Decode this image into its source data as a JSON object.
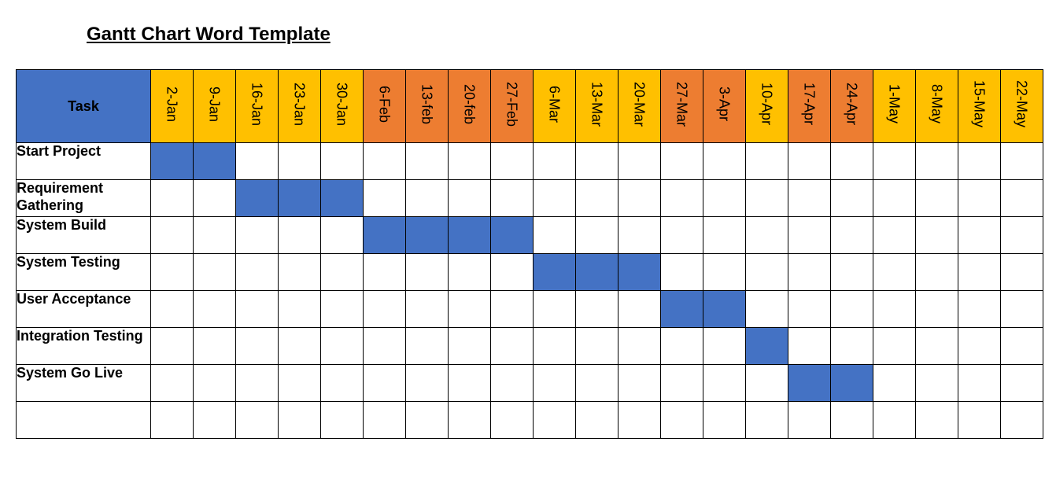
{
  "title": "Gantt Chart Word Template",
  "task_header": "Task",
  "colors": {
    "header_blue": "#4472c4",
    "bar_blue": "#4472c4",
    "month_a": "#ffc000",
    "month_b": "#ed7d31"
  },
  "columns": [
    {
      "label": "2-Jan",
      "colorKey": "month_a"
    },
    {
      "label": "9-Jan",
      "colorKey": "month_a"
    },
    {
      "label": "16-Jan",
      "colorKey": "month_a"
    },
    {
      "label": "23-Jan",
      "colorKey": "month_a"
    },
    {
      "label": "30-Jan",
      "colorKey": "month_a"
    },
    {
      "label": "6-Feb",
      "colorKey": "month_b"
    },
    {
      "label": "13-feb",
      "colorKey": "month_b"
    },
    {
      "label": "20-feb",
      "colorKey": "month_b"
    },
    {
      "label": "27-Feb",
      "colorKey": "month_b"
    },
    {
      "label": "6-Mar",
      "colorKey": "month_a"
    },
    {
      "label": "13-Mar",
      "colorKey": "month_a"
    },
    {
      "label": "20-Mar",
      "colorKey": "month_a"
    },
    {
      "label": "27-Mar",
      "colorKey": "month_b"
    },
    {
      "label": "3-Apr",
      "colorKey": "month_b"
    },
    {
      "label": "10-Apr",
      "colorKey": "month_a"
    },
    {
      "label": "17-Apr",
      "colorKey": "month_b"
    },
    {
      "label": "24-Apr",
      "colorKey": "month_b"
    },
    {
      "label": "1-May",
      "colorKey": "month_a"
    },
    {
      "label": "8-May",
      "colorKey": "month_a"
    },
    {
      "label": "15-May",
      "colorKey": "month_a"
    },
    {
      "label": "22-May",
      "colorKey": "month_a"
    }
  ],
  "tasks": [
    {
      "name": "Start Project",
      "start_col": 0,
      "end_col": 1
    },
    {
      "name": "Requirement Gathering",
      "start_col": 2,
      "end_col": 4
    },
    {
      "name": "System Build",
      "start_col": 5,
      "end_col": 8
    },
    {
      "name": "System Testing",
      "start_col": 9,
      "end_col": 11
    },
    {
      "name": "User Acceptance",
      "start_col": 12,
      "end_col": 13
    },
    {
      "name": "Integration Testing",
      "start_col": 14,
      "end_col": 14
    },
    {
      "name": "System Go Live",
      "start_col": 15,
      "end_col": 16
    }
  ],
  "chart_data": {
    "type": "bar",
    "title": "Gantt Chart Word Template",
    "xlabel": "",
    "ylabel": "",
    "categories": [
      "2-Jan",
      "9-Jan",
      "16-Jan",
      "23-Jan",
      "30-Jan",
      "6-Feb",
      "13-feb",
      "20-feb",
      "27-Feb",
      "6-Mar",
      "13-Mar",
      "20-Mar",
      "27-Mar",
      "3-Apr",
      "10-Apr",
      "17-Apr",
      "24-Apr",
      "1-May",
      "8-May",
      "15-May",
      "22-May"
    ],
    "series": [
      {
        "name": "Start Project",
        "values": [
          1,
          1,
          0,
          0,
          0,
          0,
          0,
          0,
          0,
          0,
          0,
          0,
          0,
          0,
          0,
          0,
          0,
          0,
          0,
          0,
          0
        ]
      },
      {
        "name": "Requirement Gathering",
        "values": [
          0,
          0,
          1,
          1,
          1,
          0,
          0,
          0,
          0,
          0,
          0,
          0,
          0,
          0,
          0,
          0,
          0,
          0,
          0,
          0,
          0
        ]
      },
      {
        "name": "System Build",
        "values": [
          0,
          0,
          0,
          0,
          0,
          1,
          1,
          1,
          1,
          0,
          0,
          0,
          0,
          0,
          0,
          0,
          0,
          0,
          0,
          0,
          0
        ]
      },
      {
        "name": "System Testing",
        "values": [
          0,
          0,
          0,
          0,
          0,
          0,
          0,
          0,
          0,
          1,
          1,
          1,
          0,
          0,
          0,
          0,
          0,
          0,
          0,
          0,
          0
        ]
      },
      {
        "name": "User Acceptance",
        "values": [
          0,
          0,
          0,
          0,
          0,
          0,
          0,
          0,
          0,
          0,
          0,
          0,
          1,
          1,
          0,
          0,
          0,
          0,
          0,
          0,
          0
        ]
      },
      {
        "name": "Integration Testing",
        "values": [
          0,
          0,
          0,
          0,
          0,
          0,
          0,
          0,
          0,
          0,
          0,
          0,
          0,
          0,
          1,
          0,
          0,
          0,
          0,
          0,
          0
        ]
      },
      {
        "name": "System Go Live",
        "values": [
          0,
          0,
          0,
          0,
          0,
          0,
          0,
          0,
          0,
          0,
          0,
          0,
          0,
          0,
          0,
          1,
          1,
          0,
          0,
          0,
          0
        ]
      }
    ]
  }
}
